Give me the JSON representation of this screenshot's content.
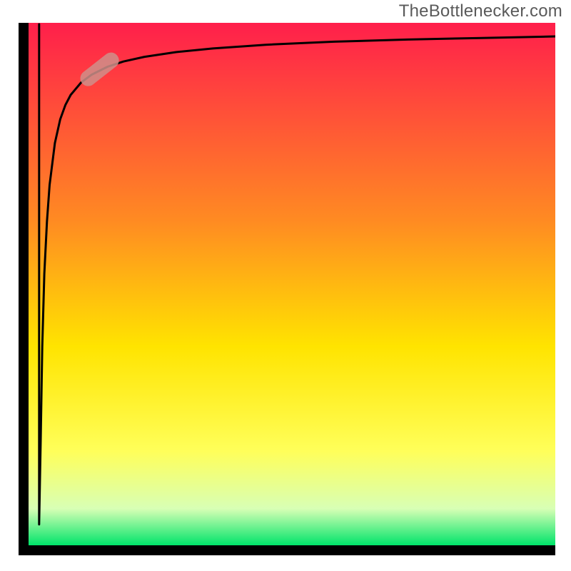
{
  "watermark": "TheBottlenecker.com",
  "chart_data": {
    "type": "line",
    "title": "",
    "xlabel": "",
    "ylabel": "",
    "xlim": [
      0,
      100
    ],
    "ylim": [
      0,
      100
    ],
    "axes": {
      "left": true,
      "bottom": true,
      "right": false,
      "top": false,
      "ticks_visible": false,
      "grid": false
    },
    "background_gradient": {
      "top": "#ff1f4b",
      "mid_upper": "#ff8b22",
      "mid": "#ffe400",
      "mid_lower": "#ffff5a",
      "near_bottom": "#d8ffb5",
      "bottom": "#00e46a"
    },
    "series": [
      {
        "name": "bottleneck-curve",
        "color": "#000000",
        "stroke_width": 2,
        "x": [
          2.0,
          2.3,
          2.6,
          3.0,
          3.5,
          4.0,
          5.0,
          6.0,
          7.0,
          8.0,
          10.0,
          12.0,
          15.0,
          18.0,
          22.0,
          28.0,
          35.0,
          45.0,
          58.0,
          72.0,
          86.0,
          100.0
        ],
        "y": [
          4.0,
          20.0,
          38.0,
          52.0,
          62.0,
          69.0,
          77.0,
          81.5,
          84.3,
          86.2,
          88.6,
          90.1,
          91.6,
          92.6,
          93.5,
          94.4,
          95.1,
          95.8,
          96.4,
          96.8,
          97.1,
          97.4
        ]
      }
    ],
    "marker": {
      "name": "highlight-pill",
      "x_center": 13.5,
      "y_center": 91.1,
      "angle_deg": -38,
      "length": 8.5,
      "thickness": 3.0,
      "fill": "#cf8f89",
      "opacity": 0.85
    }
  }
}
